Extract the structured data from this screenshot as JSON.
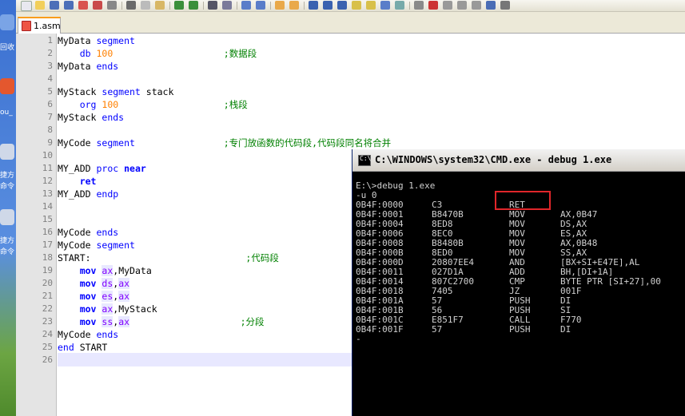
{
  "desktop": {
    "labels": [
      "回收",
      "ou_",
      "捷方",
      "命令",
      "捷方",
      "命令"
    ]
  },
  "tab": {
    "label": "1.asm"
  },
  "editor": {
    "line_numbers": [
      "1",
      "2",
      "3",
      "4",
      "5",
      "6",
      "7",
      "8",
      "9",
      "10",
      "11",
      "12",
      "13",
      "14",
      "15",
      "16",
      "17",
      "18",
      "19",
      "20",
      "21",
      "22",
      "23",
      "24",
      "25",
      "26"
    ],
    "lines": [
      [
        {
          "t": "MyData ",
          "c": ""
        },
        {
          "t": "segment",
          "c": "kw"
        }
      ],
      [
        {
          "t": "    ",
          "c": ""
        },
        {
          "t": "db",
          "c": "kw"
        },
        {
          "t": " ",
          "c": ""
        },
        {
          "t": "100",
          "c": "num"
        },
        {
          "t": "                    ",
          "c": ""
        },
        {
          "t": ";数据段",
          "c": "cm"
        }
      ],
      [
        {
          "t": "MyData ",
          "c": ""
        },
        {
          "t": "ends",
          "c": "kw"
        }
      ],
      [],
      [
        {
          "t": "MyStack ",
          "c": ""
        },
        {
          "t": "segment",
          "c": "kw"
        },
        {
          "t": " stack",
          "c": ""
        }
      ],
      [
        {
          "t": "    ",
          "c": ""
        },
        {
          "t": "org",
          "c": "kw"
        },
        {
          "t": " ",
          "c": ""
        },
        {
          "t": "100",
          "c": "num"
        },
        {
          "t": "                   ",
          "c": ""
        },
        {
          "t": ";栈段",
          "c": "cm"
        }
      ],
      [
        {
          "t": "MyStack ",
          "c": ""
        },
        {
          "t": "ends",
          "c": "kw"
        }
      ],
      [],
      [
        {
          "t": "MyCode ",
          "c": ""
        },
        {
          "t": "segment",
          "c": "kw"
        },
        {
          "t": "                ",
          "c": ""
        },
        {
          "t": ";专门放函数的代码段,代码段同名将合并",
          "c": "cm"
        }
      ],
      [],
      [
        {
          "t": "MY_ADD ",
          "c": ""
        },
        {
          "t": "proc",
          "c": "kw"
        },
        {
          "t": " ",
          "c": ""
        },
        {
          "t": "near",
          "c": "kwb"
        }
      ],
      [
        {
          "t": "    ",
          "c": ""
        },
        {
          "t": "ret",
          "c": "kwb"
        }
      ],
      [
        {
          "t": "MY_ADD ",
          "c": ""
        },
        {
          "t": "endp",
          "c": "kw"
        }
      ],
      [],
      [],
      [
        {
          "t": "MyCode ",
          "c": ""
        },
        {
          "t": "ends",
          "c": "kw"
        }
      ],
      [
        {
          "t": "MyCode ",
          "c": ""
        },
        {
          "t": "segment",
          "c": "kw"
        }
      ],
      [
        {
          "t": "START:",
          "c": ""
        },
        {
          "t": "                            ",
          "c": ""
        },
        {
          "t": ";代码段",
          "c": "cm"
        }
      ],
      [
        {
          "t": "    ",
          "c": ""
        },
        {
          "t": "mov",
          "c": "kwb"
        },
        {
          "t": " ",
          "c": ""
        },
        {
          "t": "ax",
          "c": "reg"
        },
        {
          "t": ",MyData",
          "c": ""
        }
      ],
      [
        {
          "t": "    ",
          "c": ""
        },
        {
          "t": "mov",
          "c": "kwb"
        },
        {
          "t": " ",
          "c": ""
        },
        {
          "t": "ds",
          "c": "reg"
        },
        {
          "t": ",",
          "c": ""
        },
        {
          "t": "ax",
          "c": "reg"
        }
      ],
      [
        {
          "t": "    ",
          "c": ""
        },
        {
          "t": "mov",
          "c": "kwb"
        },
        {
          "t": " ",
          "c": ""
        },
        {
          "t": "es",
          "c": "reg"
        },
        {
          "t": ",",
          "c": ""
        },
        {
          "t": "ax",
          "c": "reg"
        }
      ],
      [
        {
          "t": "    ",
          "c": ""
        },
        {
          "t": "mov",
          "c": "kwb"
        },
        {
          "t": " ",
          "c": ""
        },
        {
          "t": "ax",
          "c": "reg"
        },
        {
          "t": ",MyStack",
          "c": ""
        }
      ],
      [
        {
          "t": "    ",
          "c": ""
        },
        {
          "t": "mov",
          "c": "kwb"
        },
        {
          "t": " ",
          "c": ""
        },
        {
          "t": "ss",
          "c": "reg"
        },
        {
          "t": ",",
          "c": ""
        },
        {
          "t": "ax",
          "c": "reg"
        },
        {
          "t": "                    ",
          "c": ""
        },
        {
          "t": ";分段",
          "c": "cm"
        }
      ],
      [
        {
          "t": "MyCode ",
          "c": ""
        },
        {
          "t": "ends",
          "c": "kw"
        }
      ],
      [
        {
          "t": "end",
          "c": "kw"
        },
        {
          "t": " START",
          "c": ""
        }
      ],
      []
    ]
  },
  "console": {
    "title": "C:\\WINDOWS\\system32\\CMD.exe - debug 1.exe",
    "prompt_line": "E:\\>debug 1.exe",
    "command_line": "-u 0",
    "rows": [
      {
        "addr": "0B4F:0000",
        "hex": "C3",
        "op": "RET",
        "args": ""
      },
      {
        "addr": "0B4F:0001",
        "hex": "B8470B",
        "op": "MOV",
        "args": "AX,0B47"
      },
      {
        "addr": "0B4F:0004",
        "hex": "8ED8",
        "op": "MOV",
        "args": "DS,AX"
      },
      {
        "addr": "0B4F:0006",
        "hex": "8EC0",
        "op": "MOV",
        "args": "ES,AX"
      },
      {
        "addr": "0B4F:0008",
        "hex": "B8480B",
        "op": "MOV",
        "args": "AX,0B48"
      },
      {
        "addr": "0B4F:000B",
        "hex": "8ED0",
        "op": "MOV",
        "args": "SS,AX"
      },
      {
        "addr": "0B4F:000D",
        "hex": "20807EE4",
        "op": "AND",
        "args": "[BX+SI+E47E],AL"
      },
      {
        "addr": "0B4F:0011",
        "hex": "027D1A",
        "op": "ADD",
        "args": "BH,[DI+1A]"
      },
      {
        "addr": "0B4F:0014",
        "hex": "807C2700",
        "op": "CMP",
        "args": "BYTE PTR [SI+27],00"
      },
      {
        "addr": "0B4F:0018",
        "hex": "7405",
        "op": "JZ",
        "args": "001F"
      },
      {
        "addr": "0B4F:001A",
        "hex": "57",
        "op": "PUSH",
        "args": "DI"
      },
      {
        "addr": "0B4F:001B",
        "hex": "56",
        "op": "PUSH",
        "args": "SI"
      },
      {
        "addr": "0B4F:001C",
        "hex": "E851F7",
        "op": "CALL",
        "args": "F770"
      },
      {
        "addr": "0B4F:001F",
        "hex": "57",
        "op": "PUSH",
        "args": "DI"
      }
    ],
    "cursor_line": "-"
  },
  "colors": {
    "keyword": "#0000ff",
    "number": "#ff8000",
    "comment": "#008000",
    "register": "#8000ff",
    "highlight_box": "#e0262a"
  }
}
